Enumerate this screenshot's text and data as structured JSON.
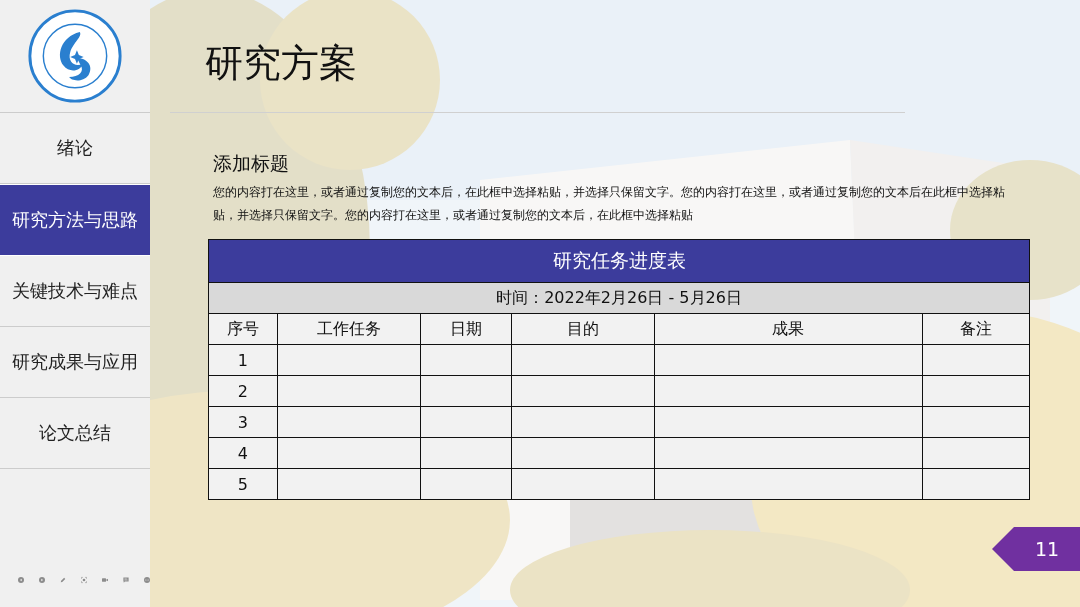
{
  "sidebar": {
    "items": [
      {
        "label": "绪论",
        "selected": false
      },
      {
        "label": "研究方法与思路",
        "selected": true
      },
      {
        "label": "关键技术与难点",
        "selected": false
      },
      {
        "label": "研究成果与应用",
        "selected": false
      },
      {
        "label": "论文总结",
        "selected": false
      }
    ]
  },
  "slide": {
    "title": "研究方案",
    "subtitle": "添加标题",
    "body": "您的内容打在这里，或者通过复制您的文本后，在此框中选择粘贴，并选择只保留文字。您的内容打在这里，或者通过复制您的文本后在此框中选择粘贴，并选择只保留文字。您的内容打在这里，或者通过复制您的文本后，在此框中选择粘贴",
    "table": {
      "title": "研究任务进度表",
      "period": "时间：2022年2月26日 - 5月26日",
      "columns": [
        "序号",
        "工作任务",
        "日期",
        "目的",
        "成果",
        "备注"
      ],
      "rows": [
        {
          "number": "1"
        },
        {
          "number": "2"
        },
        {
          "number": "3"
        },
        {
          "number": "4"
        },
        {
          "number": "5"
        }
      ]
    },
    "page_number": "11"
  }
}
